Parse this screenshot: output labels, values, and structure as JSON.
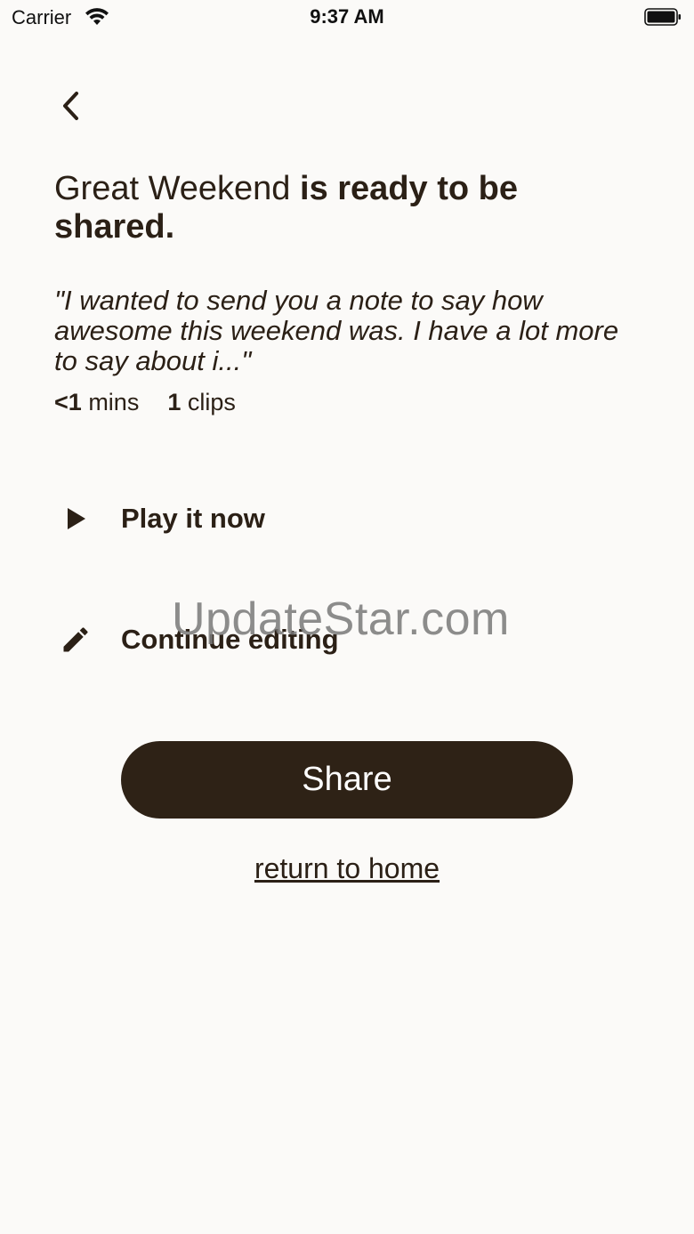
{
  "status_bar": {
    "carrier": "Carrier",
    "time": "9:37 AM"
  },
  "header": {
    "back_icon": "chevron-left-icon"
  },
  "summary": {
    "title_name": "Great Weekend",
    "title_rest": "is ready to be shared.",
    "quote": "\"I wanted to send you a note to say how awesome this weekend was. I have a lot more to say about i...\"",
    "duration_value": "<1",
    "duration_unit": "mins",
    "clips_value": "1",
    "clips_unit": "clips"
  },
  "actions": {
    "play_label": "Play it now",
    "play_icon": "play-icon",
    "edit_label": "Continue editing",
    "edit_icon": "pencil-icon"
  },
  "watermark": "UpdateStar.com",
  "share_label": "Share",
  "home_link_label": "return to home",
  "colors": {
    "background": "#fbfaf8",
    "text": "#2b2016",
    "button": "#2e2216"
  }
}
